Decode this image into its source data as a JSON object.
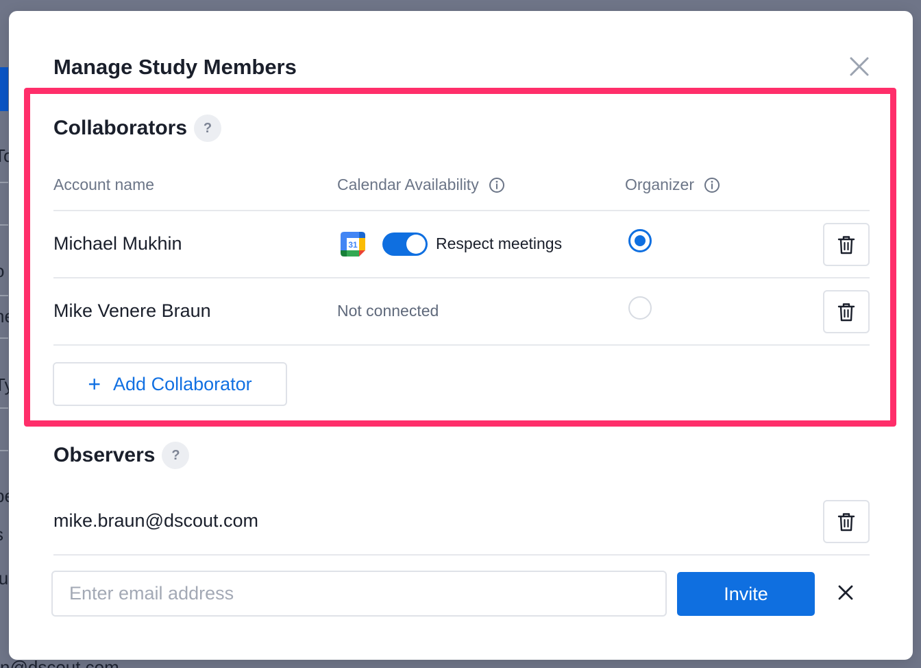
{
  "backdrop": {
    "fragments": [
      "To",
      "o",
      "ne",
      "Ty",
      "pe",
      "s",
      "lu"
    ],
    "bottom_text": "n@dscout.com"
  },
  "modal": {
    "title": "Manage Study Members",
    "close_icon": "close-icon"
  },
  "collaborators": {
    "title": "Collaborators",
    "help_label": "?",
    "columns": {
      "account_name": "Account name",
      "calendar_availability": "Calendar Availability",
      "organizer": "Organizer"
    },
    "rows": [
      {
        "name": "Michael Mukhin",
        "calendar_icon": "google-calendar-icon",
        "calendar_day": "31",
        "toggle_label": "Respect meetings",
        "toggle_on": true,
        "organizer": true
      },
      {
        "name": "Mike Venere Braun",
        "calendar_status": "Not connected",
        "organizer": false
      }
    ],
    "add_button": {
      "icon": "plus-icon",
      "label": "Add Collaborator"
    }
  },
  "observers": {
    "title": "Observers",
    "help_label": "?",
    "rows": [
      {
        "email": "mike.braun@dscout.com"
      }
    ],
    "invite_form": {
      "placeholder": "Enter email address",
      "value": "",
      "invite_label": "Invite",
      "cancel_icon": "close-icon"
    }
  },
  "colors": {
    "accent": "#0f6fe0",
    "highlight": "#ff2e6a",
    "overlay": "#6f7588"
  }
}
